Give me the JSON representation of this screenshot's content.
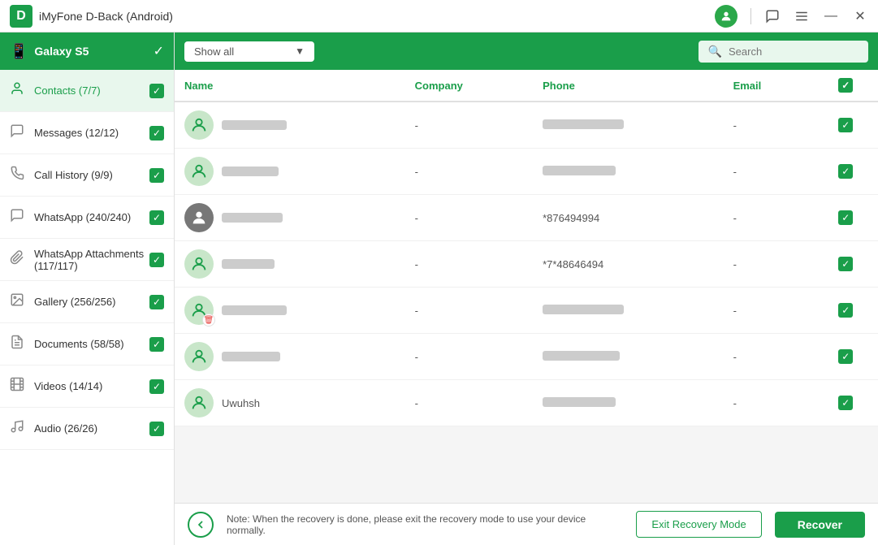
{
  "titlebar": {
    "logo": "D",
    "title": "iMyFone D-Back (Android)",
    "controls": {
      "minimize": "—",
      "maximize": "☐",
      "close": "✕"
    }
  },
  "sidebar": {
    "device_name": "Galaxy S5",
    "items": [
      {
        "id": "contacts",
        "label": "Contacts (7/7)",
        "icon": "👤",
        "active": true,
        "checked": true
      },
      {
        "id": "messages",
        "label": "Messages (12/12)",
        "icon": "💬",
        "active": false,
        "checked": true
      },
      {
        "id": "call-history",
        "label": "Call History (9/9)",
        "icon": "📞",
        "active": false,
        "checked": true
      },
      {
        "id": "whatsapp",
        "label": "WhatsApp (240/240)",
        "icon": "💬",
        "active": false,
        "checked": true
      },
      {
        "id": "whatsapp-attachments",
        "label": "WhatsApp Attachments (117/117)",
        "icon": "📎",
        "active": false,
        "checked": true
      },
      {
        "id": "gallery",
        "label": "Gallery (256/256)",
        "icon": "🖼",
        "active": false,
        "checked": true
      },
      {
        "id": "documents",
        "label": "Documents (58/58)",
        "icon": "📄",
        "active": false,
        "checked": true
      },
      {
        "id": "videos",
        "label": "Videos (14/14)",
        "icon": "🎬",
        "active": false,
        "checked": true
      },
      {
        "id": "audio",
        "label": "Audio (26/26)",
        "icon": "🎵",
        "active": false,
        "checked": true
      }
    ]
  },
  "content_header": {
    "dropdown_text": "Show all",
    "search_placeholder": "Search"
  },
  "table": {
    "columns": [
      "Name",
      "Company",
      "Phone",
      "Email",
      ""
    ],
    "rows": [
      {
        "id": 1,
        "name_blurred": true,
        "name_width": 80,
        "company": "-",
        "phone_blurred": true,
        "phone_width": 100,
        "email": "-",
        "checked": true,
        "avatar_type": "person",
        "deleted": false,
        "has_photo": false
      },
      {
        "id": 2,
        "name_blurred": true,
        "name_width": 70,
        "company": "-",
        "phone_blurred": true,
        "phone_width": 90,
        "email": "-",
        "checked": true,
        "avatar_type": "person",
        "deleted": false,
        "has_photo": false
      },
      {
        "id": 3,
        "name_blurred": true,
        "name_width": 75,
        "company": "-",
        "phone": "*876494994",
        "phone_blurred": false,
        "email": "-",
        "checked": true,
        "avatar_type": "photo",
        "deleted": false,
        "has_photo": true
      },
      {
        "id": 4,
        "name_blurred": true,
        "name_width": 65,
        "company": "-",
        "phone": "*7*48646494",
        "phone_blurred": false,
        "email": "-",
        "checked": true,
        "avatar_type": "person",
        "deleted": false,
        "has_photo": false
      },
      {
        "id": 5,
        "name_blurred": true,
        "name_width": 80,
        "company": "-",
        "phone_blurred": true,
        "phone_width": 100,
        "email": "-",
        "checked": true,
        "avatar_type": "person",
        "deleted": true,
        "has_photo": false
      },
      {
        "id": 6,
        "name_blurred": true,
        "name_width": 72,
        "company": "-",
        "phone_blurred": true,
        "phone_width": 95,
        "email": "-",
        "checked": true,
        "avatar_type": "person",
        "deleted": false,
        "has_photo": false
      },
      {
        "id": 7,
        "name": "Uwuhsh",
        "name_blurred": false,
        "company": "-",
        "phone_blurred": true,
        "phone_width": 90,
        "email": "-",
        "checked": true,
        "avatar_type": "person",
        "deleted": false,
        "has_photo": false
      }
    ]
  },
  "footer": {
    "note": "Note: When the recovery is done, please exit the recovery mode to use your device normally.",
    "exit_button_label": "Exit Recovery Mode",
    "recover_button_label": "Recover"
  }
}
